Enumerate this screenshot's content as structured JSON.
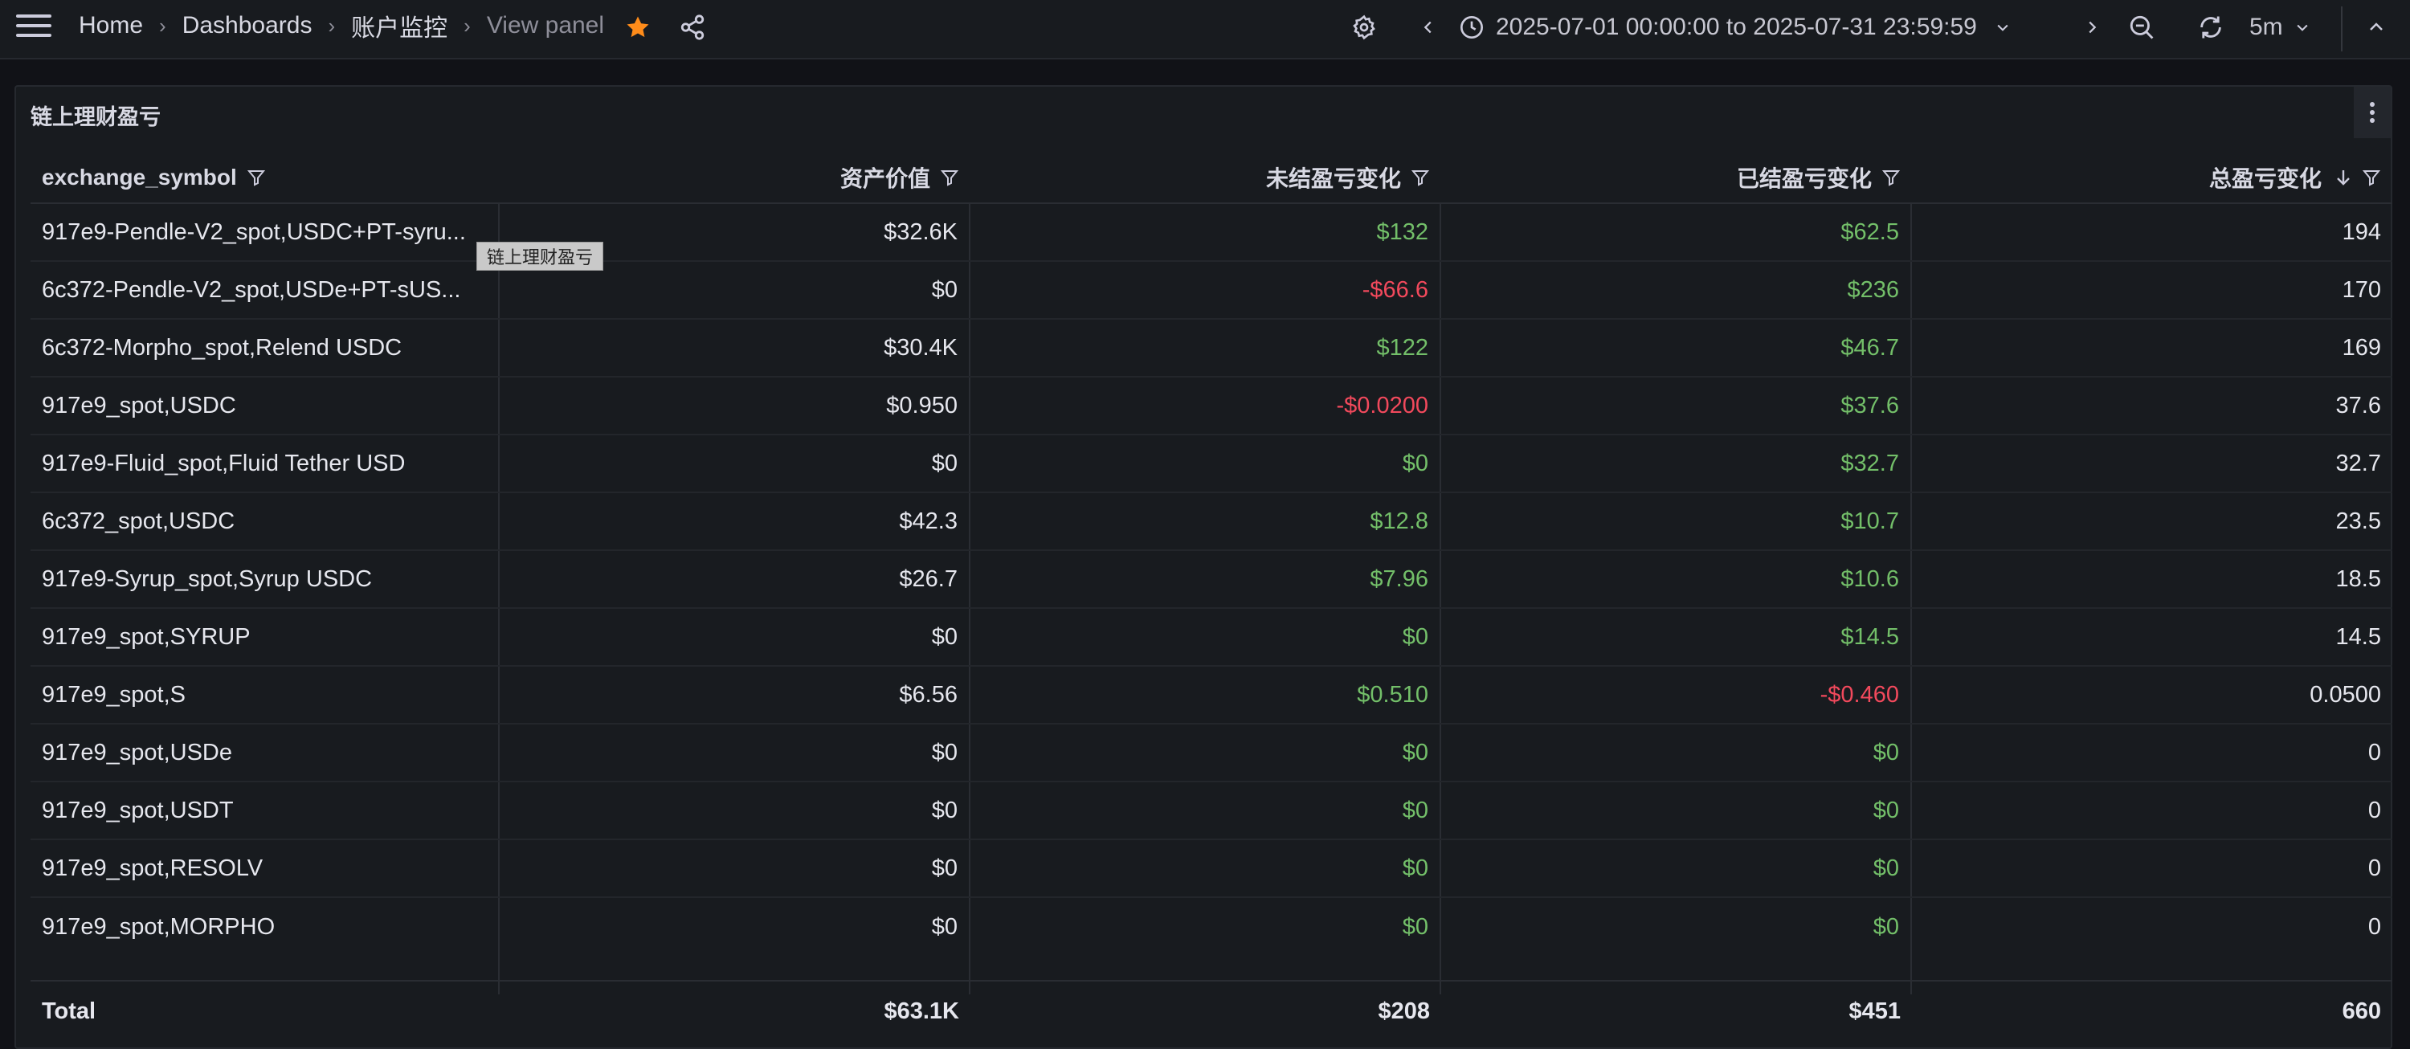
{
  "nav": {
    "breadcrumbs": [
      "Home",
      "Dashboards",
      "账户监控",
      "View panel"
    ],
    "time_range": "2025-07-01 00:00:00 to 2025-07-31 23:59:59",
    "refresh_interval": "5m",
    "star_color": "#ff8c1a",
    "icons": [
      "menu-icon",
      "star-icon",
      "share-icon",
      "settings-icon",
      "chevron-left-icon",
      "clock-icon",
      "chevron-down-icon",
      "chevron-right-icon",
      "zoom-out-icon",
      "refresh-icon",
      "chevron-up-icon"
    ]
  },
  "panel": {
    "title": "链上理财盈亏",
    "tooltip": "链上理财盈亏",
    "columns": [
      "exchange_symbol",
      "资产价值",
      "未结盈亏变化",
      "已结盈亏变化",
      "总盈亏变化"
    ],
    "sort": {
      "column": "总盈亏变化",
      "direction": "desc"
    },
    "rows": [
      {
        "symbol": "917e9-Pendle-V2_spot,USDC+PT-syru...",
        "value": "$32.6K",
        "unrealized": "$132",
        "realized": "$62.5",
        "total": "194"
      },
      {
        "symbol": "6c372-Pendle-V2_spot,USDe+PT-sUS...",
        "value": "$0",
        "unrealized": "-$66.6",
        "realized": "$236",
        "total": "170"
      },
      {
        "symbol": "6c372-Morpho_spot,Relend USDC",
        "value": "$30.4K",
        "unrealized": "$122",
        "realized": "$46.7",
        "total": "169"
      },
      {
        "symbol": "917e9_spot,USDC",
        "value": "$0.950",
        "unrealized": "-$0.0200",
        "realized": "$37.6",
        "total": "37.6"
      },
      {
        "symbol": "917e9-Fluid_spot,Fluid Tether USD",
        "value": "$0",
        "unrealized": "$0",
        "realized": "$32.7",
        "total": "32.7"
      },
      {
        "symbol": "6c372_spot,USDC",
        "value": "$42.3",
        "unrealized": "$12.8",
        "realized": "$10.7",
        "total": "23.5"
      },
      {
        "symbol": "917e9-Syrup_spot,Syrup USDC",
        "value": "$26.7",
        "unrealized": "$7.96",
        "realized": "$10.6",
        "total": "18.5"
      },
      {
        "symbol": "917e9_spot,SYRUP",
        "value": "$0",
        "unrealized": "$0",
        "realized": "$14.5",
        "total": "14.5"
      },
      {
        "symbol": "917e9_spot,S",
        "value": "$6.56",
        "unrealized": "$0.510",
        "realized": "-$0.460",
        "total": "0.0500"
      },
      {
        "symbol": "917e9_spot,USDe",
        "value": "$0",
        "unrealized": "$0",
        "realized": "$0",
        "total": "0"
      },
      {
        "symbol": "917e9_spot,USDT",
        "value": "$0",
        "unrealized": "$0",
        "realized": "$0",
        "total": "0"
      },
      {
        "symbol": "917e9_spot,RESOLV",
        "value": "$0",
        "unrealized": "$0",
        "realized": "$0",
        "total": "0"
      },
      {
        "symbol": "917e9_spot,MORPHO",
        "value": "$0",
        "unrealized": "$0",
        "realized": "$0",
        "total": "0"
      }
    ],
    "footer": {
      "label": "Total",
      "value": "$63.1K",
      "unrealized": "$208",
      "realized": "$451",
      "total": "660"
    },
    "colors": {
      "positive": "#73bf69",
      "negative": "#f2495c"
    }
  }
}
